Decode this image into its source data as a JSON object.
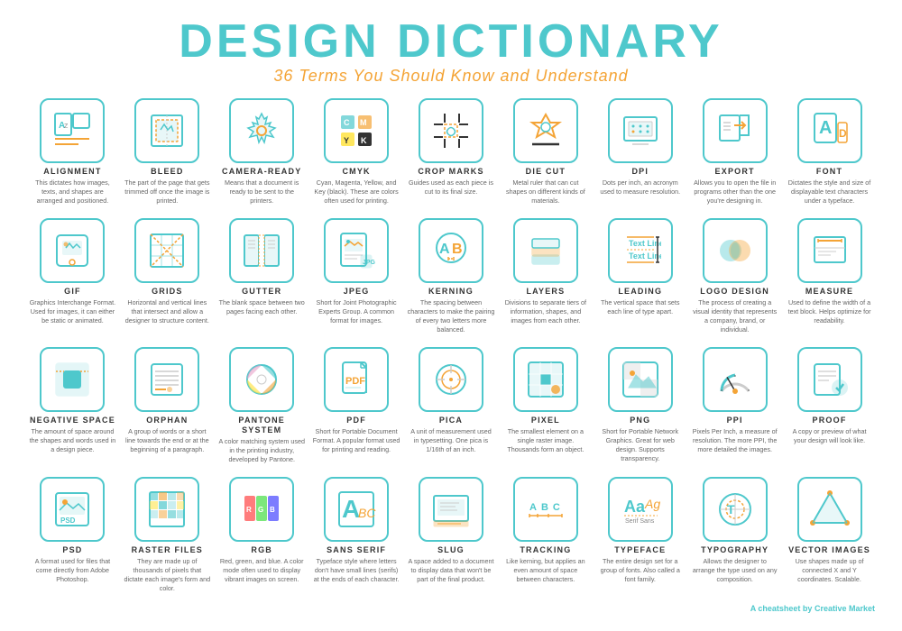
{
  "header": {
    "title": "DESIGN DICTIONARY",
    "subtitle": "36 Terms You Should Know and Understand"
  },
  "footer": {
    "text": "A cheatsheet by",
    "brand": "Creative Market"
  },
  "terms": [
    {
      "name": "ALIGNMENT",
      "desc": "This dictates how images, texts, and shapes are arranged and positioned.",
      "icon": "alignment"
    },
    {
      "name": "BLEED",
      "desc": "The part of the page that gets trimmed off once the image is printed.",
      "icon": "bleed"
    },
    {
      "name": "CAMERA-READY",
      "desc": "Means that a document is ready to be sent to the printers.",
      "icon": "camera-ready"
    },
    {
      "name": "CMYK",
      "desc": "Cyan, Magenta, Yellow, and Key (black). These are colors often used for printing.",
      "icon": "cmyk"
    },
    {
      "name": "CROP MARKS",
      "desc": "Guides used as each piece is cut to its final size.",
      "icon": "crop-marks"
    },
    {
      "name": "DIE CUT",
      "desc": "Metal ruler that can cut shapes on different kinds of materials.",
      "icon": "die-cut"
    },
    {
      "name": "DPI",
      "desc": "Dots per inch, an acronym used to measure resolution.",
      "icon": "dpi"
    },
    {
      "name": "EXPORT",
      "desc": "Allows you to open the file in programs other than the one you're designing in.",
      "icon": "export"
    },
    {
      "name": "FONT",
      "desc": "Dictates the style and size of displayable text characters under a typeface.",
      "icon": "font"
    },
    {
      "name": "GIF",
      "desc": "Graphics Interchange Format. Used for images, it can either be static or animated.",
      "icon": "gif"
    },
    {
      "name": "GRIDS",
      "desc": "Horizontal and vertical lines that intersect and allow a designer to structure content.",
      "icon": "grids"
    },
    {
      "name": "GUTTER",
      "desc": "The blank space between two pages facing each other.",
      "icon": "gutter"
    },
    {
      "name": "JPEG",
      "desc": "Short for Joint Photographic Experts Group. A common format for images.",
      "icon": "jpeg"
    },
    {
      "name": "KERNING",
      "desc": "The spacing between characters to make the pairing of every two letters more balanced.",
      "icon": "kerning"
    },
    {
      "name": "LAYERS",
      "desc": "Divisions to separate tiers of information, shapes, and images from each other.",
      "icon": "layers"
    },
    {
      "name": "LEADING",
      "desc": "The vertical space that sets each line of type apart.",
      "icon": "leading"
    },
    {
      "name": "LOGO DESIGN",
      "desc": "The process of creating a visual identity that represents a company, brand, or individual.",
      "icon": "logo-design"
    },
    {
      "name": "MEASURE",
      "desc": "Used to define the width of a text block. Helps optimize for readability.",
      "icon": "measure"
    },
    {
      "name": "NEGATIVE SPACE",
      "desc": "The amount of space around the shapes and words used in a design piece.",
      "icon": "negative-space"
    },
    {
      "name": "ORPHAN",
      "desc": "A group of words or a short line towards the end or at the beginning of a paragraph.",
      "icon": "orphan"
    },
    {
      "name": "PANTONE SYSTEM",
      "desc": "A color matching system used in the printing industry, developed by Pantone.",
      "icon": "pantone"
    },
    {
      "name": "PDF",
      "desc": "Short for Portable Document Format. A popular format used for printing and reading.",
      "icon": "pdf"
    },
    {
      "name": "PICA",
      "desc": "A unit of measurement used in typesetting. One pica is 1/16th of an inch.",
      "icon": "pica"
    },
    {
      "name": "PIXEL",
      "desc": "The smallest element on a single raster image. Thousands form an object.",
      "icon": "pixel"
    },
    {
      "name": "PNG",
      "desc": "Short for Portable Network Graphics. Great for web design. Supports transparency.",
      "icon": "png"
    },
    {
      "name": "PPI",
      "desc": "Pixels Per Inch, a measure of resolution. The more PPI, the more detailed the images.",
      "icon": "ppi"
    },
    {
      "name": "PROOF",
      "desc": "A copy or preview of what your design will look like.",
      "icon": "proof"
    },
    {
      "name": "PSD",
      "desc": "A format used for files that come directly from Adobe Photoshop.",
      "icon": "psd"
    },
    {
      "name": "RASTER FILES",
      "desc": "They are made up of thousands of pixels that dictate each image's form and color.",
      "icon": "raster"
    },
    {
      "name": "RGB",
      "desc": "Red, green, and blue. A color mode often used to display vibrant images on screen.",
      "icon": "rgb"
    },
    {
      "name": "SANS SERIF",
      "desc": "Typeface style where letters don't have small lines (serifs) at the ends of each character.",
      "icon": "sans-serif"
    },
    {
      "name": "SLUG",
      "desc": "A space added to a document to display data that won't be part of the final product.",
      "icon": "slug"
    },
    {
      "name": "TRACKING",
      "desc": "Like kerning, but applies an even amount of space between characters.",
      "icon": "tracking"
    },
    {
      "name": "TYPEFACE",
      "desc": "The entire design set for a group of fonts. Also called a font family.",
      "icon": "typeface"
    },
    {
      "name": "TYPOGRAPHY",
      "desc": "Allows the designer to arrange the type used on any composition.",
      "icon": "typography"
    },
    {
      "name": "VECTOR IMAGES",
      "desc": "Use shapes made up of connected X and Y coordinates. Scalable.",
      "icon": "vector"
    }
  ]
}
